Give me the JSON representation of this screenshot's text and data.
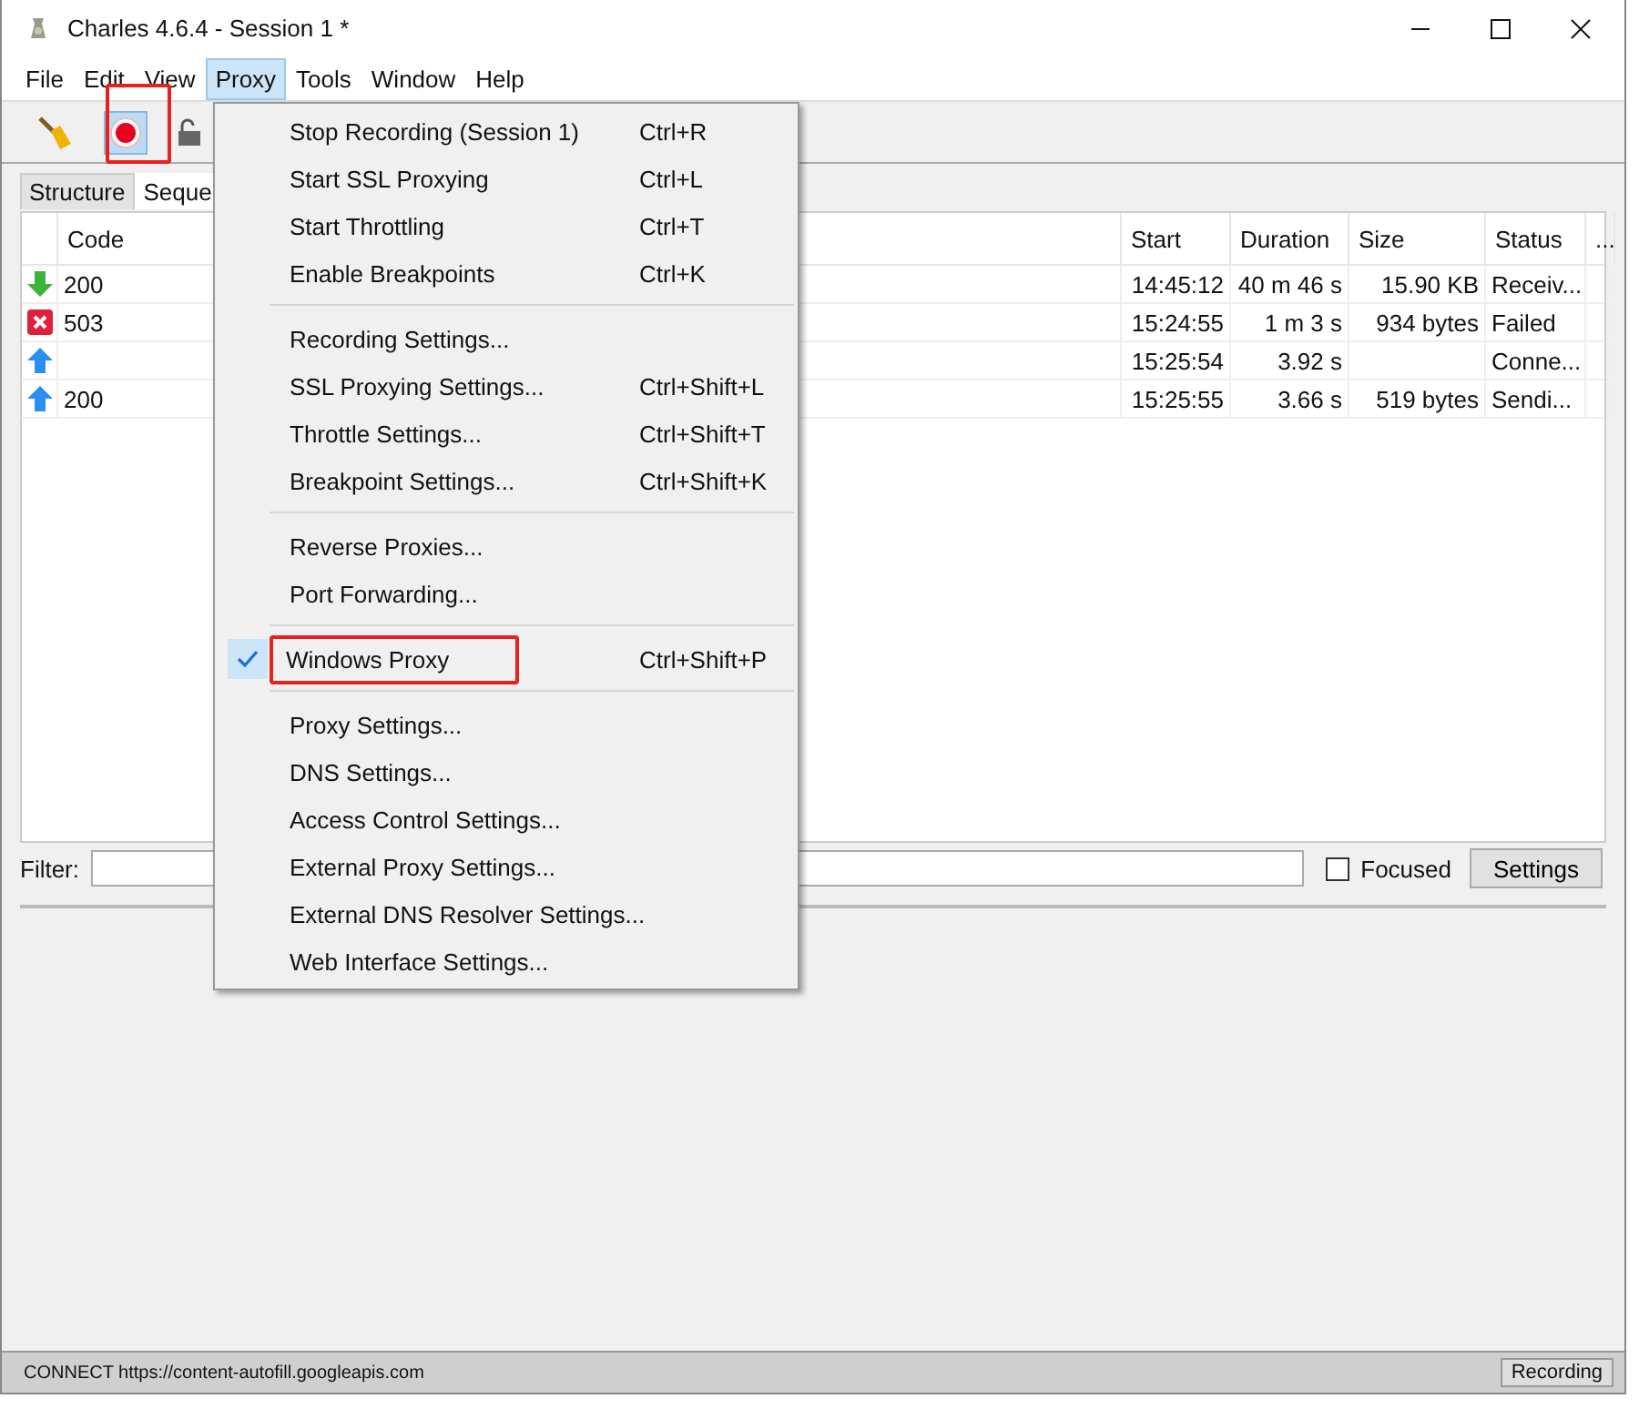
{
  "window": {
    "title": "Charles 4.6.4 - Session 1 *"
  },
  "menu_bar": [
    {
      "label": "File",
      "selected": false
    },
    {
      "label": "Edit",
      "selected": false
    },
    {
      "label": "View",
      "selected": false
    },
    {
      "label": "Proxy",
      "selected": true
    },
    {
      "label": "Tools",
      "selected": false
    },
    {
      "label": "Window",
      "selected": false
    },
    {
      "label": "Help",
      "selected": false
    }
  ],
  "toolbar": {
    "recording": true
  },
  "tabs": [
    {
      "label": "Structure",
      "selected": false
    },
    {
      "label": "Seque",
      "selected": true
    }
  ],
  "table": {
    "columns": [
      "Code",
      "Start",
      "Duration",
      "Size",
      "Status",
      "..."
    ],
    "rows": [
      {
        "kind": "received",
        "code": "200",
        "start": "14:45:12",
        "duration": "40 m 46 s",
        "size": "15.90 KB",
        "status": "Receiv..."
      },
      {
        "kind": "failed",
        "code": "503",
        "start": "15:24:55",
        "duration": "1 m 3 s",
        "size": "934 bytes",
        "status": "Failed"
      },
      {
        "kind": "sending",
        "code": "",
        "start": "15:25:54",
        "duration": "3.92 s",
        "size": "",
        "status": "Conne..."
      },
      {
        "kind": "sending",
        "code": "200",
        "start": "15:25:55",
        "duration": "3.66 s",
        "size": "519 bytes",
        "status": "Sendi..."
      }
    ]
  },
  "filter": {
    "label": "Filter:",
    "focused_label": "Focused",
    "focused_checked": false,
    "settings_button": "Settings"
  },
  "proxy_menu": [
    {
      "kind": "item",
      "label": "Stop Recording (Session 1)",
      "shortcut": "Ctrl+R",
      "checked": false,
      "highlighted": false
    },
    {
      "kind": "item",
      "label": "Start SSL Proxying",
      "shortcut": "Ctrl+L",
      "checked": false,
      "highlighted": false
    },
    {
      "kind": "item",
      "label": "Start Throttling",
      "shortcut": "Ctrl+T",
      "checked": false,
      "highlighted": false
    },
    {
      "kind": "item",
      "label": "Enable Breakpoints",
      "shortcut": "Ctrl+K",
      "checked": false,
      "highlighted": false
    },
    {
      "kind": "separator"
    },
    {
      "kind": "item",
      "label": "Recording Settings...",
      "checked": false,
      "highlighted": false
    },
    {
      "kind": "item",
      "label": "SSL Proxying Settings...",
      "shortcut": "Ctrl+Shift+L",
      "checked": false,
      "highlighted": false
    },
    {
      "kind": "item",
      "label": "Throttle Settings...",
      "shortcut": "Ctrl+Shift+T",
      "checked": false,
      "highlighted": false
    },
    {
      "kind": "item",
      "label": "Breakpoint Settings...",
      "shortcut": "Ctrl+Shift+K",
      "checked": false,
      "highlighted": false
    },
    {
      "kind": "separator"
    },
    {
      "kind": "item",
      "label": "Reverse Proxies...",
      "checked": false,
      "highlighted": false
    },
    {
      "kind": "item",
      "label": "Port Forwarding...",
      "checked": false,
      "highlighted": false
    },
    {
      "kind": "separator"
    },
    {
      "kind": "item",
      "label": "Windows Proxy",
      "shortcut": "Ctrl+Shift+P",
      "checked": true,
      "highlighted": true
    },
    {
      "kind": "separator"
    },
    {
      "kind": "item",
      "label": "Proxy Settings...",
      "checked": false,
      "highlighted": false
    },
    {
      "kind": "item",
      "label": "DNS Settings...",
      "checked": false,
      "highlighted": false
    },
    {
      "kind": "item",
      "label": "Access Control Settings...",
      "checked": false,
      "highlighted": false
    },
    {
      "kind": "item",
      "label": "External Proxy Settings...",
      "checked": false,
      "highlighted": false
    },
    {
      "kind": "item",
      "label": "External DNS Resolver Settings...",
      "checked": false,
      "highlighted": false
    },
    {
      "kind": "item",
      "label": "Web Interface Settings...",
      "checked": false,
      "highlighted": false
    }
  ],
  "status_bar": {
    "text": "CONNECT https://content-autofill.googleapis.com",
    "button": "Recording"
  }
}
